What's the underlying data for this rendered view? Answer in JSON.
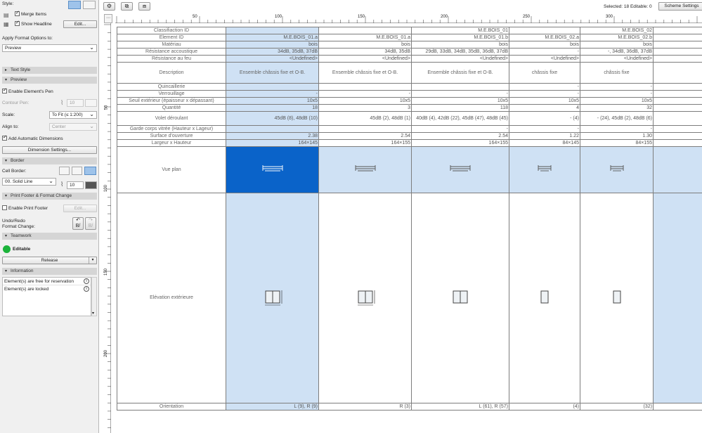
{
  "left_panel": {
    "style_label": "Style:",
    "merge_items": "Merge Items",
    "show_headline": "Show Headline",
    "edit_label": "Edit...",
    "apply_format_label": "Apply Format Options to:",
    "apply_format_value": "Preview",
    "text_style_section": "Text Style",
    "preview_section": "Preview",
    "enable_pen": "Enable Element's Pen",
    "contour_pen_label": "Contour Pen:",
    "contour_pen_value": "10",
    "scale_label": "Scale:",
    "scale_value": "To Fit (≤ 1:200)",
    "align_label": "Align to:",
    "align_value": "Center",
    "add_dimensions": "Add Automatic Dimensions",
    "dimension_settings": "Dimension Settings...",
    "border_section": "Border",
    "cell_border_label": "Cell Border:",
    "line_type": "00. Solid Line",
    "border_pen_value": "10",
    "print_footer_section": "Print Footer & Format Change",
    "enable_print_footer": "Enable Print Footer",
    "footer_edit": "Edit...",
    "undo_redo_label": "Undo/Redo",
    "format_change_label": "Format Change:",
    "teamwork_section": "Teamwork",
    "editable_label": "Editable",
    "release_label": "Release",
    "information_section": "Information",
    "info_items": [
      "Element(s) are free for reservation",
      "Element(s) are locked"
    ]
  },
  "status": {
    "selected": "Selected: 18  Editable: 0",
    "scheme_settings": "Scheme Settings"
  },
  "ruler": {
    "top": [
      "50",
      "100",
      "150",
      "200",
      "250",
      "300"
    ],
    "left": [
      "50",
      "100",
      "150",
      "200"
    ]
  },
  "schedule": {
    "row_labels": {
      "classification": "Classifiaction ID",
      "element_id": "Element ID",
      "materiau": "Matériau",
      "acoustic": "Résistance accoustique",
      "fire": "Résistance au feu",
      "description": "Description",
      "quincaillerie": "Quincaillerie",
      "verrouillage": "Verrouillage",
      "seuil": "Seuil extérieur (épaisseur x dépassant)",
      "quantite": "Quantité",
      "volet": "Volet déroulant",
      "garde_corps": "Garde corps vitrée    (Hauteur x Lageur)",
      "surface": "Surface d'ouverture",
      "dimensions": "Largeur x Hauteur",
      "vue_plan": "Vue plan",
      "elevation": "Elévation extérieure",
      "orientation": "Orientation"
    },
    "columns": [
      {
        "classification": "",
        "element_id": "M.E.BOIS_01.a",
        "materiau": "bois",
        "acoustic": "34dB, 35dB, 37dB",
        "fire": "<Undefined>",
        "description": "Ensemble châssis fixe et O-B.",
        "quincaillerie": "",
        "verrouillage": "-",
        "seuil": "10x5",
        "quantite": "18",
        "volet": "45dB (8), 48dB (10)",
        "garde_corps": "",
        "surface": "2.38",
        "dimensions": "164×145",
        "orientation": "L (9), R (9)"
      },
      {
        "classification": "",
        "element_id": "M.E.BOIS_01.a",
        "materiau": "bois",
        "acoustic": "34dB, 35dB",
        "fire": "<Undefined>",
        "description": "Ensemble châssis fixe et O-B.",
        "quincaillerie": "",
        "verrouillage": "-",
        "seuil": "10x5",
        "quantite": "3",
        "volet": "45dB (2), 48dB (1)",
        "garde_corps": "",
        "surface": "2.54",
        "dimensions": "164×155",
        "orientation": "R (3)"
      },
      {
        "classification": "M.E.BOIS_01",
        "element_id": "M.E.BOIS_01.b",
        "materiau": "bois",
        "acoustic": "29dB, 33dB, 34dB, 35dB, 36dB, 37dB",
        "fire": "<Undefined>",
        "description": "Ensemble châssis fixe et O-B.",
        "quincaillerie": "",
        "verrouillage": "-",
        "seuil": "10x5",
        "quantite": "118",
        "volet": "40dB (4), 42dB (22), 45dB (47), 48dB (45)",
        "garde_corps": "-",
        "surface": "2.54",
        "dimensions": "164×155",
        "orientation": "L (61), R (57)"
      },
      {
        "classification": "",
        "element_id": "M.E.BOIS_02.a",
        "materiau": "bois",
        "acoustic": "-",
        "fire": "<Undefined>",
        "description": "châssis fixe",
        "quincaillerie": "-",
        "verrouillage": "-",
        "seuil": "10x5",
        "quantite": "4",
        "volet": "- (4)",
        "garde_corps": "-",
        "surface": "1.22",
        "dimensions": "84×145",
        "orientation": "(4)"
      },
      {
        "classification": "M.E.BOIS_02",
        "element_id": "M.E.BOIS_02.b",
        "materiau": "bois",
        "acoustic": "-, 34dB, 36dB, 37dB",
        "fire": "<Undefined>",
        "description": "châssis fixe",
        "quincaillerie": "-",
        "verrouillage": "-",
        "seuil": "10x5",
        "quantite": "32",
        "volet": "- (24), 45dB (2), 48dB (6)",
        "garde_corps": "-",
        "surface": "1.30",
        "dimensions": "84×155",
        "orientation": "(32)"
      }
    ]
  },
  "colors": {
    "selection_light": "#cfe1f4",
    "selection_dark": "#0a63c9",
    "teamwork_green": "#1bb33a"
  }
}
